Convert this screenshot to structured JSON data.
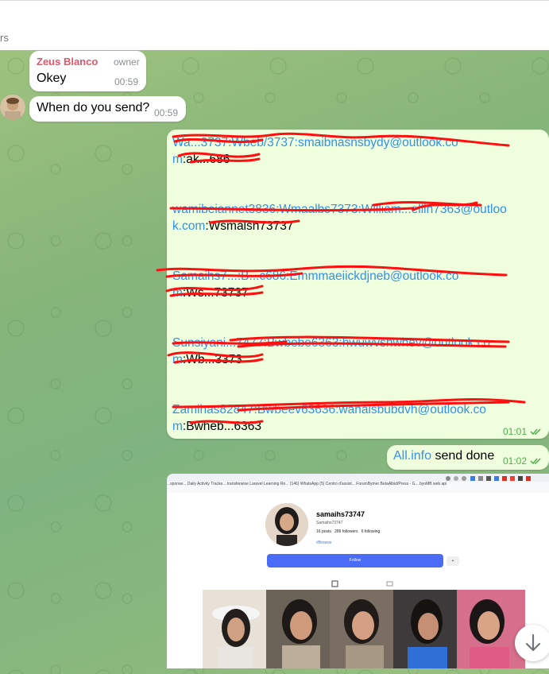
{
  "header": {
    "subtitle": "rs"
  },
  "messages": {
    "m1": {
      "sender": "Zeus Blanco",
      "role": "owner",
      "text": "Okey",
      "time": "00:59"
    },
    "m2": {
      "text": "When do you send?",
      "time": "00:59"
    },
    "m3": {
      "entries": [
        {
          "link": "Wa...3737:Wbeb/3737:smaibnasnsbydy@outlook.co",
          "link2": "m",
          "pw": ":ak...686"
        },
        {
          "link": "wamibeiannet3836:Wmaalbs7373:William...ellin7363@outloo",
          "link2": "k.com",
          "pw": ":Wsmalsh73737"
        },
        {
          "link": "Samaihs7...:B...c686:Emmmaeiickdjneb@outlook.co",
          "link2": "m",
          "pw": ":Ws...73737"
        },
        {
          "link": "Sunsiyani...7477:Bwbebe6363:hwuwvshwhev@outlook.co",
          "link2": "m",
          "pw": ":Wb...3373"
        },
        {
          "link": "Zamihas82847:Bwbeev63636:wanaisbubdvh@outlook.co",
          "link2": "m",
          "pw": ":Bwheb...6363"
        }
      ],
      "time": "01:01"
    },
    "m4": {
      "link": "All.info",
      "text": " send done",
      "time": "01:02"
    },
    "m5": {
      "profile_name": "samaihs73747",
      "profile_sub": "Samaihs73747",
      "stats": "16 posts   286 followers   6 following",
      "tag": "#Browse",
      "follow_label": "Follow",
      "bookmarks": "...sponse...   Daily Activity Tracke...   transferwise   Laravel Learning Ro...   (146) WhatsApp   (5) Centro d'assist...   ForumBymer   BetaAlbid/Press - G...   byoMB   web   api"
    }
  },
  "colors": {
    "sender_name": "#e0566c",
    "link": "#3390ec",
    "outgoing_bubble": "#effedd",
    "outgoing_time": "#4fae4e",
    "redaction": "#ff1010",
    "follow_button": "#4a6cf7"
  },
  "icons": {
    "scroll_down": "arrow-down-icon",
    "read_receipt": "double-check-icon"
  }
}
